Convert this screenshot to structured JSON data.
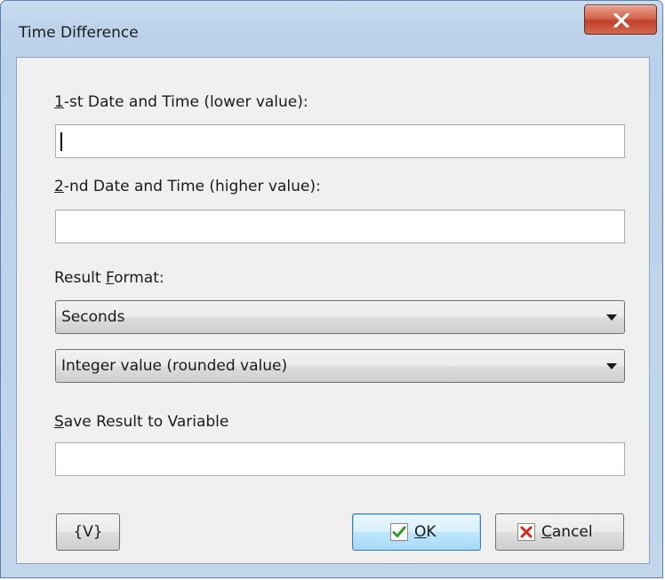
{
  "window": {
    "title": "Time Difference"
  },
  "form": {
    "first_label_mnemonic": "1",
    "first_label_rest": "-st Date and Time (lower value):",
    "first_value": "",
    "second_label_mnemonic": "2",
    "second_label_rest": "-nd Date and Time (higher value):",
    "second_value": "",
    "result_format_label_pre": "Result ",
    "result_format_label_mnemonic": "F",
    "result_format_label_rest": "ormat:",
    "unit_selected": "Seconds",
    "value_type_selected": "Integer value (rounded value)",
    "save_label_mnemonic": "S",
    "save_label_rest": "ave Result to Variable",
    "save_value": ""
  },
  "buttons": {
    "variables_label": "{V}",
    "ok_mnemonic": "O",
    "ok_rest": "K",
    "cancel_mnemonic": "C",
    "cancel_rest": "ancel"
  },
  "colors": {
    "ok_check": "#2e9a28",
    "cancel_x": "#d0281c"
  },
  "icons": {
    "close": "close-icon",
    "ok": "checkmark-icon",
    "cancel": "x-mark-icon",
    "dropdown": "chevron-down-icon"
  }
}
